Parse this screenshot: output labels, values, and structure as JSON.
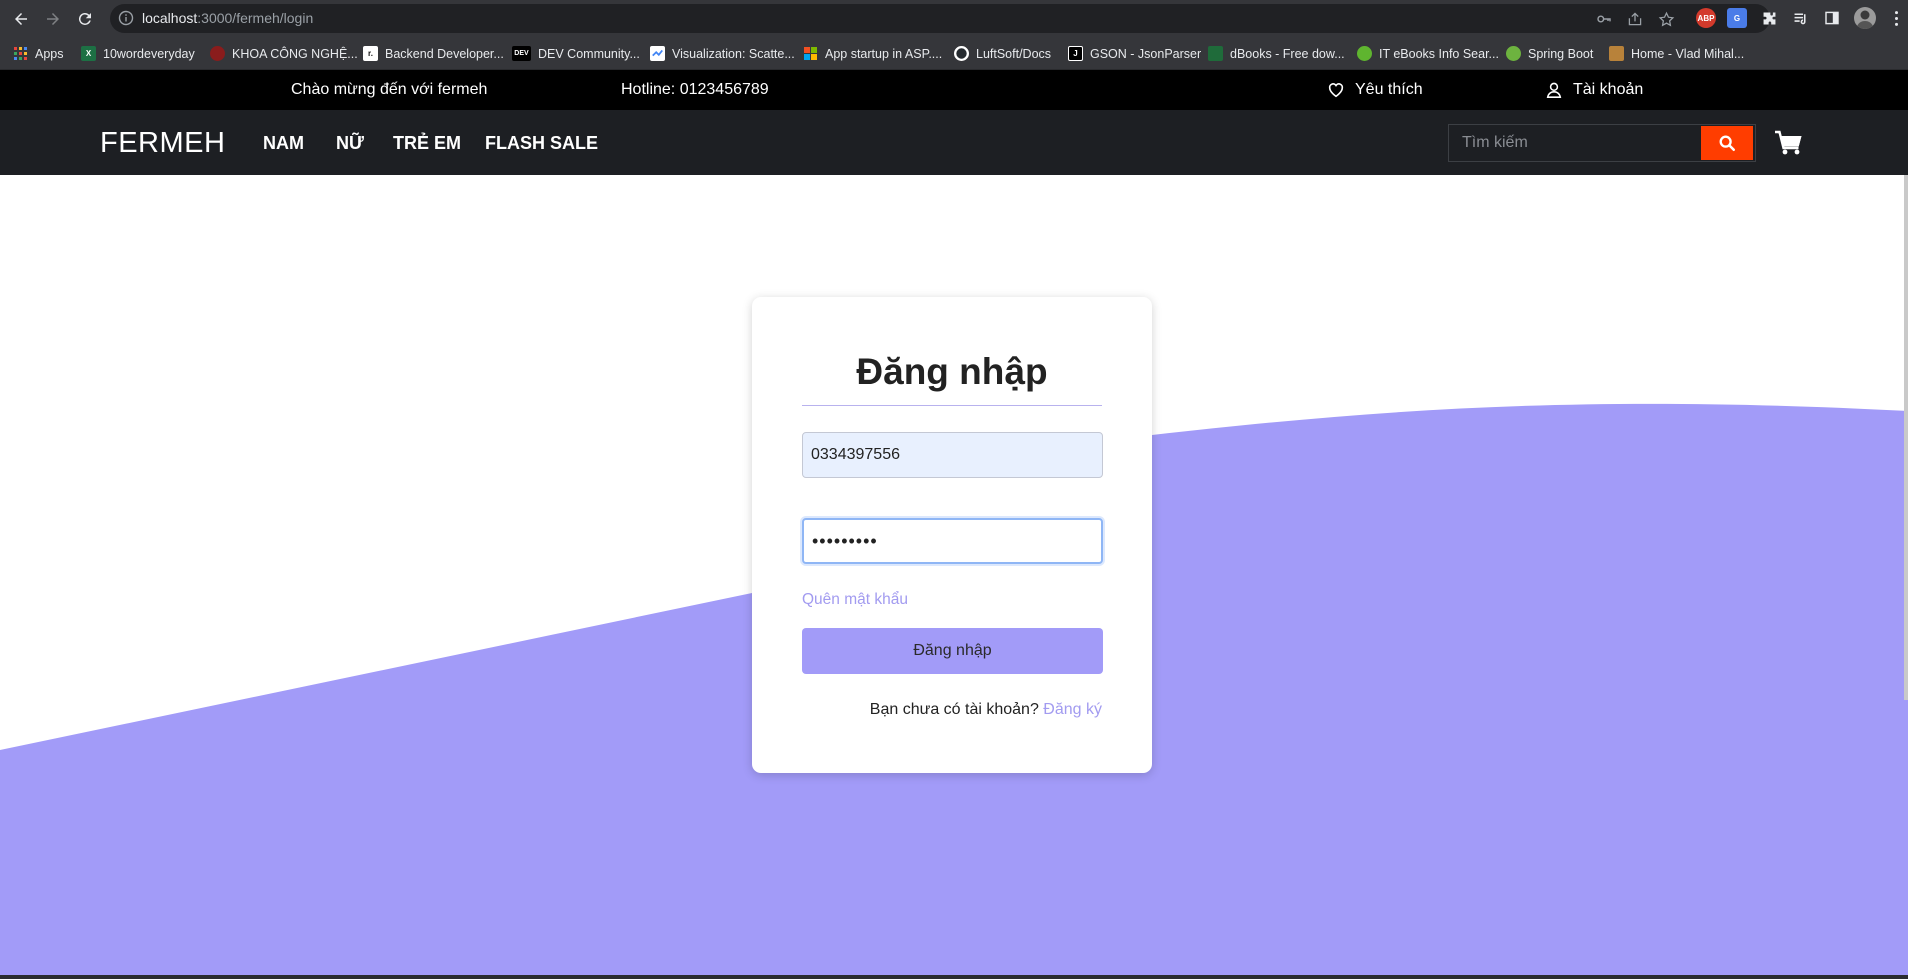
{
  "browser": {
    "url_host": "localhost",
    "url_path": ":3000/fermeh/login",
    "bookmarks": [
      {
        "label": "Apps",
        "icon": "apps-grid-icon",
        "color": "#e8453c"
      },
      {
        "label": "10wordeveryday",
        "icon": "excel-icon",
        "color": "#1d7044"
      },
      {
        "label": "KHOA CÔNG NGHỆ...",
        "icon": "school-icon",
        "color": "#8a1c1c"
      },
      {
        "label": "Backend Developer...",
        "icon": "r-icon",
        "color": "#111111"
      },
      {
        "label": "DEV Community...",
        "icon": "dev-icon",
        "color": "#000000"
      },
      {
        "label": "Visualization: Scatte...",
        "icon": "google-charts-icon",
        "color": "#ffffff"
      },
      {
        "label": "App startup in ASP....",
        "icon": "microsoft-icon",
        "color": "#f25022"
      },
      {
        "label": "LuftSoft/Docs",
        "icon": "github-icon",
        "color": "#ffffff"
      },
      {
        "label": "GSON - JsonParser",
        "icon": "j-icon",
        "color": "#000000"
      },
      {
        "label": "dBooks - Free dow...",
        "icon": "dbooks-icon",
        "color": "#1f6b3a"
      },
      {
        "label": "IT eBooks Info Sear...",
        "icon": "itebooks-icon",
        "color": "#5fb52f"
      },
      {
        "label": "Spring Boot",
        "icon": "spring-icon",
        "color": "#6db33f"
      },
      {
        "label": "Home - Vlad Mihal...",
        "icon": "vlad-icon",
        "color": "#b8823a"
      }
    ]
  },
  "topbar": {
    "welcome": "Chào mừng đến với fermeh",
    "hotline": "Hotline: 0123456789",
    "favorites": "Yêu thích",
    "account": "Tài khoản"
  },
  "nav": {
    "logo": "FERMEH",
    "menu": [
      "NAM",
      "NỮ",
      "TRẺ EM",
      "FLASH SALE"
    ],
    "search_placeholder": "Tìm kiếm"
  },
  "login": {
    "title": "Đăng nhập",
    "phone_value": "0334397556",
    "password_value": "•••••••••",
    "forgot": "Quên mật khẩu",
    "submit": "Đăng nhập",
    "no_account": "Bạn chưa có tài khoản?",
    "signup": "Đăng ký"
  },
  "colors": {
    "accent": "#a29bf8",
    "search_button": "#ff3d00",
    "nav_bg": "#1d1f23",
    "topbar_bg": "#000000"
  }
}
